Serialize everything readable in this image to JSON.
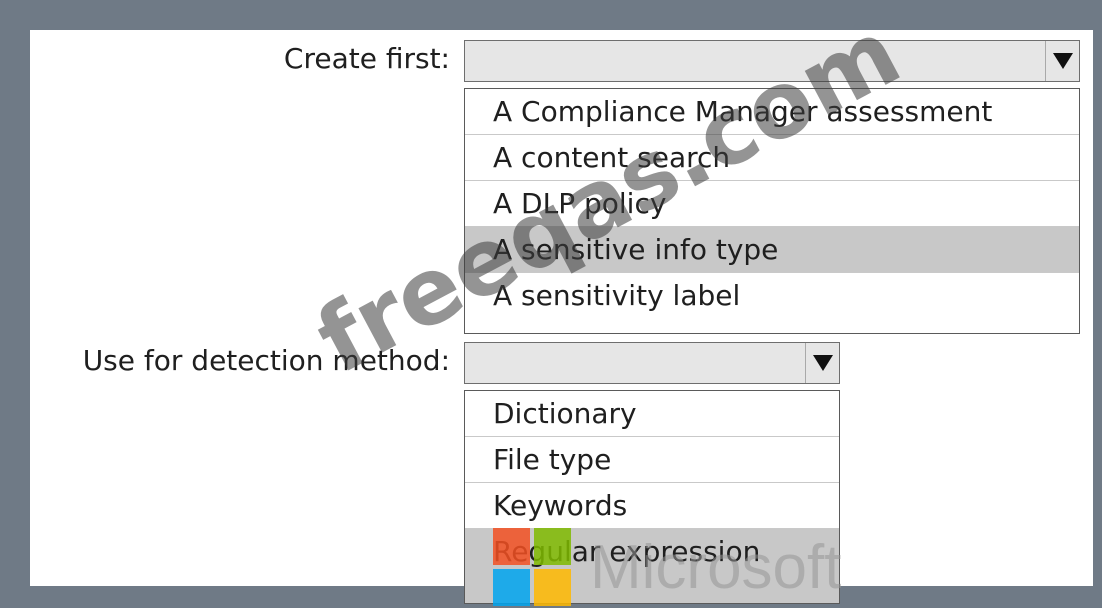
{
  "question1": {
    "label": "Create first:",
    "selected_value": "",
    "options": [
      {
        "label": "A Compliance Manager assessment",
        "selected": false
      },
      {
        "label": "A content search",
        "selected": false
      },
      {
        "label": "A DLP policy",
        "selected": false
      },
      {
        "label": "A sensitive info type",
        "selected": true
      },
      {
        "label": "A sensitivity label",
        "selected": false
      }
    ]
  },
  "question2": {
    "label": "Use for detection method:",
    "selected_value": "",
    "options": [
      {
        "label": "Dictionary",
        "selected": false
      },
      {
        "label": "File type",
        "selected": false
      },
      {
        "label": "Keywords",
        "selected": false
      },
      {
        "label": "Regular expression",
        "selected": true
      }
    ]
  },
  "watermark": {
    "text": "freeqas.com",
    "brand": "Microsoft"
  },
  "colors": {
    "frame": "#6f7a86",
    "selected_option": "#c8c8c8",
    "select_bg": "#e6e6e6",
    "ms_red": "#f25022",
    "ms_green": "#7fba00",
    "ms_blue": "#00a4ef",
    "ms_yellow": "#ffb900"
  }
}
